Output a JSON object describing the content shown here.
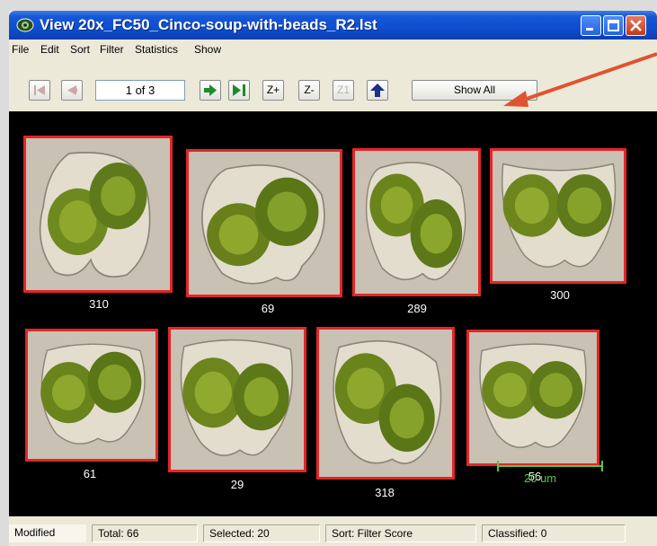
{
  "window": {
    "title": "View  20x_FC50_Cinco-soup-with-beads_R2.lst",
    "app_icon": "microscope-eye-icon",
    "controls": [
      "minimize-icon",
      "maximize-icon",
      "close-icon"
    ]
  },
  "menu": {
    "items": [
      "File",
      "Edit",
      "Sort",
      "Filter",
      "Statistics",
      "Show"
    ]
  },
  "toolbar": {
    "first_icon": "first-page-icon",
    "prev_icon": "previous-page-icon",
    "page_indicator": "1 of 3",
    "next_icon": "next-page-icon",
    "last_icon": "last-page-icon",
    "zoom_in": "Z+",
    "zoom_out": "Z-",
    "zoom_reset": "Z1",
    "up_icon": "up-arrow-icon",
    "show_all": "Show All"
  },
  "images": [
    {
      "label": "310"
    },
    {
      "label": "69"
    },
    {
      "label": "289"
    },
    {
      "label": "300"
    },
    {
      "label": "61"
    },
    {
      "label": "29"
    },
    {
      "label": "318"
    },
    {
      "label": "56"
    }
  ],
  "scale": {
    "label": "20 um"
  },
  "status": {
    "modified": "Modified",
    "total": "Total: 66",
    "selected": "Selected: 20",
    "sort": "Sort: Filter Score",
    "classified": "Classified: 0"
  },
  "colors": {
    "title_bar": "#0e4ecf",
    "thumb_border": "#e32626",
    "scale_bar": "#4fc94a",
    "annotation_arrow": "#e0532f"
  }
}
